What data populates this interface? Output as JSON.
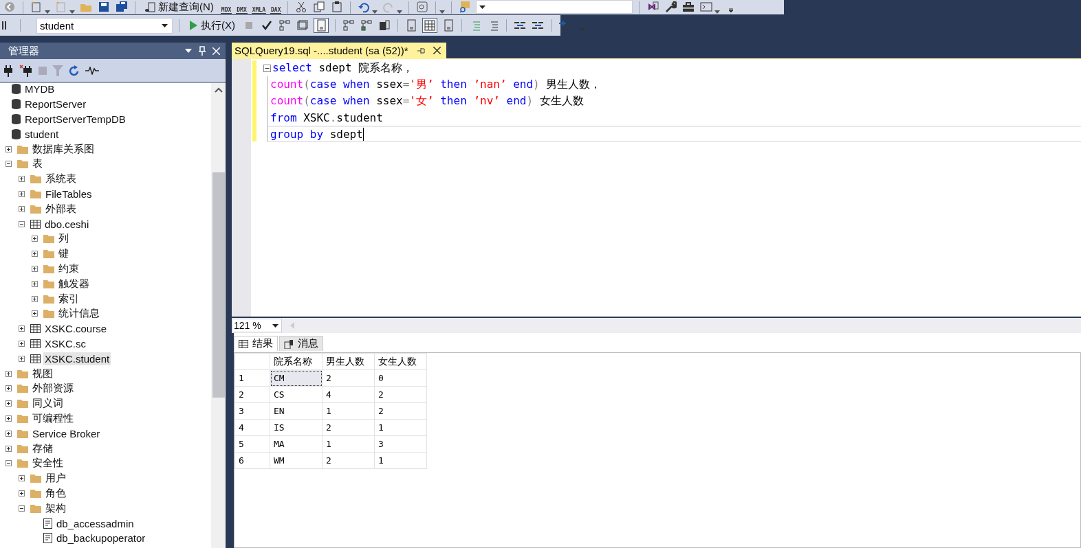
{
  "toolbar_top": {
    "new_query_label": "新建查询(N)",
    "query_types": [
      "MDX",
      "DMX",
      "XMLA",
      "DAX"
    ]
  },
  "toolbar_query": {
    "database": "student",
    "execute_label": "执行(X)"
  },
  "object_explorer": {
    "title": "管理器",
    "tree": [
      {
        "label": "MYDB",
        "kind": "database",
        "selected": false
      },
      {
        "label": "ReportServer",
        "kind": "database",
        "selected": false
      },
      {
        "label": "ReportServerTempDB",
        "kind": "database",
        "selected": false
      },
      {
        "label": "student",
        "kind": "database",
        "selected": false,
        "children": [
          {
            "label": "数据库关系图",
            "kind": "folder",
            "selected": false,
            "expanded": false
          },
          {
            "label": "表",
            "kind": "folder",
            "selected": false,
            "expanded": true,
            "children": [
              {
                "label": "系统表",
                "kind": "folder",
                "selected": false,
                "expanded": false
              },
              {
                "label": "FileTables",
                "kind": "folder",
                "selected": false,
                "expanded": false
              },
              {
                "label": "外部表",
                "kind": "folder",
                "selected": false,
                "expanded": false
              },
              {
                "label": "dbo.ceshi",
                "kind": "table",
                "selected": false,
                "expanded": true,
                "children": [
                  {
                    "label": "列",
                    "kind": "folder",
                    "selected": false,
                    "expanded": false
                  },
                  {
                    "label": "键",
                    "kind": "folder",
                    "selected": false,
                    "expanded": false
                  },
                  {
                    "label": "约束",
                    "kind": "folder",
                    "selected": false,
                    "expanded": false
                  },
                  {
                    "label": "触发器",
                    "kind": "folder",
                    "selected": false,
                    "expanded": false
                  },
                  {
                    "label": "索引",
                    "kind": "folder",
                    "selected": false,
                    "expanded": false
                  },
                  {
                    "label": "统计信息",
                    "kind": "folder",
                    "selected": false,
                    "expanded": false
                  }
                ]
              },
              {
                "label": "XSKC.course",
                "kind": "table",
                "selected": false,
                "expanded": false
              },
              {
                "label": "XSKC.sc",
                "kind": "table",
                "selected": false,
                "expanded": false
              },
              {
                "label": "XSKC.student",
                "kind": "table",
                "selected": true,
                "expanded": false
              }
            ]
          },
          {
            "label": "视图",
            "kind": "folder",
            "selected": false,
            "expanded": false
          },
          {
            "label": "外部资源",
            "kind": "folder",
            "selected": false,
            "expanded": false
          },
          {
            "label": "同义词",
            "kind": "folder",
            "selected": false,
            "expanded": false
          },
          {
            "label": "可编程性",
            "kind": "folder",
            "selected": false,
            "expanded": false
          },
          {
            "label": "Service Broker",
            "kind": "folder",
            "selected": false,
            "expanded": false
          },
          {
            "label": "存储",
            "kind": "folder",
            "selected": false,
            "expanded": false
          },
          {
            "label": "安全性",
            "kind": "folder",
            "selected": false,
            "expanded": true,
            "children": [
              {
                "label": "用户",
                "kind": "folder",
                "selected": false,
                "expanded": false
              },
              {
                "label": "角色",
                "kind": "folder",
                "selected": false,
                "expanded": false
              },
              {
                "label": "架构",
                "kind": "folder",
                "selected": false,
                "expanded": true,
                "children": [
                  {
                    "label": "db_accessadmin",
                    "kind": "schema",
                    "selected": false
                  },
                  {
                    "label": "db_backupoperator",
                    "kind": "schema",
                    "selected": false
                  }
                ]
              }
            ]
          }
        ]
      }
    ]
  },
  "editor_tab": {
    "title": "SQLQuery19.sql -....student (sa (52))*",
    "selected": true
  },
  "code_lines": [
    {
      "cursor": false,
      "tokens": [
        {
          "kind": "keyword",
          "text": "select"
        },
        {
          "kind": "plain",
          "text": " sdept 院系名称，"
        }
      ]
    },
    {
      "cursor": false,
      "tokens": [
        {
          "kind": "function",
          "text": "count"
        },
        {
          "kind": "operator",
          "text": "("
        },
        {
          "kind": "keyword",
          "text": "case when"
        },
        {
          "kind": "plain",
          "text": " ssex"
        },
        {
          "kind": "operator",
          "text": "="
        },
        {
          "kind": "string",
          "text": "'男’"
        },
        {
          "kind": "keyword",
          "text": " then "
        },
        {
          "kind": "string",
          "text": "’nan’"
        },
        {
          "kind": "keyword",
          "text": " end"
        },
        {
          "kind": "operator",
          "text": ")"
        },
        {
          "kind": "plain",
          "text": " 男生人数，"
        }
      ]
    },
    {
      "cursor": false,
      "tokens": [
        {
          "kind": "function",
          "text": "count"
        },
        {
          "kind": "operator",
          "text": "("
        },
        {
          "kind": "keyword",
          "text": "case when"
        },
        {
          "kind": "plain",
          "text": " ssex"
        },
        {
          "kind": "operator",
          "text": "="
        },
        {
          "kind": "string",
          "text": "'女’"
        },
        {
          "kind": "keyword",
          "text": " then "
        },
        {
          "kind": "string",
          "text": "’nv’"
        },
        {
          "kind": "keyword",
          "text": " end"
        },
        {
          "kind": "operator",
          "text": ")"
        },
        {
          "kind": "plain",
          "text": " 女生人数"
        }
      ]
    },
    {
      "cursor": false,
      "tokens": [
        {
          "kind": "keyword",
          "text": "from"
        },
        {
          "kind": "plain",
          "text": " XSKC"
        },
        {
          "kind": "operator",
          "text": "."
        },
        {
          "kind": "plain",
          "text": "student"
        }
      ]
    },
    {
      "cursor": true,
      "tokens": [
        {
          "kind": "keyword",
          "text": "group by"
        },
        {
          "kind": "plain",
          "text": " sdept"
        }
      ]
    }
  ],
  "zoom": "121 %",
  "result_tabs": [
    {
      "label": "结果",
      "selected": true
    },
    {
      "label": "消息",
      "selected": false
    }
  ],
  "results": {
    "columns": [
      "院系名称",
      "男生人数",
      "女生人数"
    ],
    "rows": [
      {
        "number": "1",
        "cells": [
          {
            "text": "CM",
            "selected": true
          },
          {
            "text": "2",
            "selected": false
          },
          {
            "text": "0",
            "selected": false
          }
        ]
      },
      {
        "number": "2",
        "cells": [
          {
            "text": "CS",
            "selected": false
          },
          {
            "text": "4",
            "selected": false
          },
          {
            "text": "2",
            "selected": false
          }
        ]
      },
      {
        "number": "3",
        "cells": [
          {
            "text": "EN",
            "selected": false
          },
          {
            "text": "1",
            "selected": false
          },
          {
            "text": "2",
            "selected": false
          }
        ]
      },
      {
        "number": "4",
        "cells": [
          {
            "text": "IS",
            "selected": false
          },
          {
            "text": "2",
            "selected": false
          },
          {
            "text": "1",
            "selected": false
          }
        ]
      },
      {
        "number": "5",
        "cells": [
          {
            "text": "MA",
            "selected": false
          },
          {
            "text": "1",
            "selected": false
          },
          {
            "text": "3",
            "selected": false
          }
        ]
      },
      {
        "number": "6",
        "cells": [
          {
            "text": "WM",
            "selected": false
          },
          {
            "text": "2",
            "selected": false
          },
          {
            "text": "1",
            "selected": false
          }
        ]
      }
    ]
  }
}
